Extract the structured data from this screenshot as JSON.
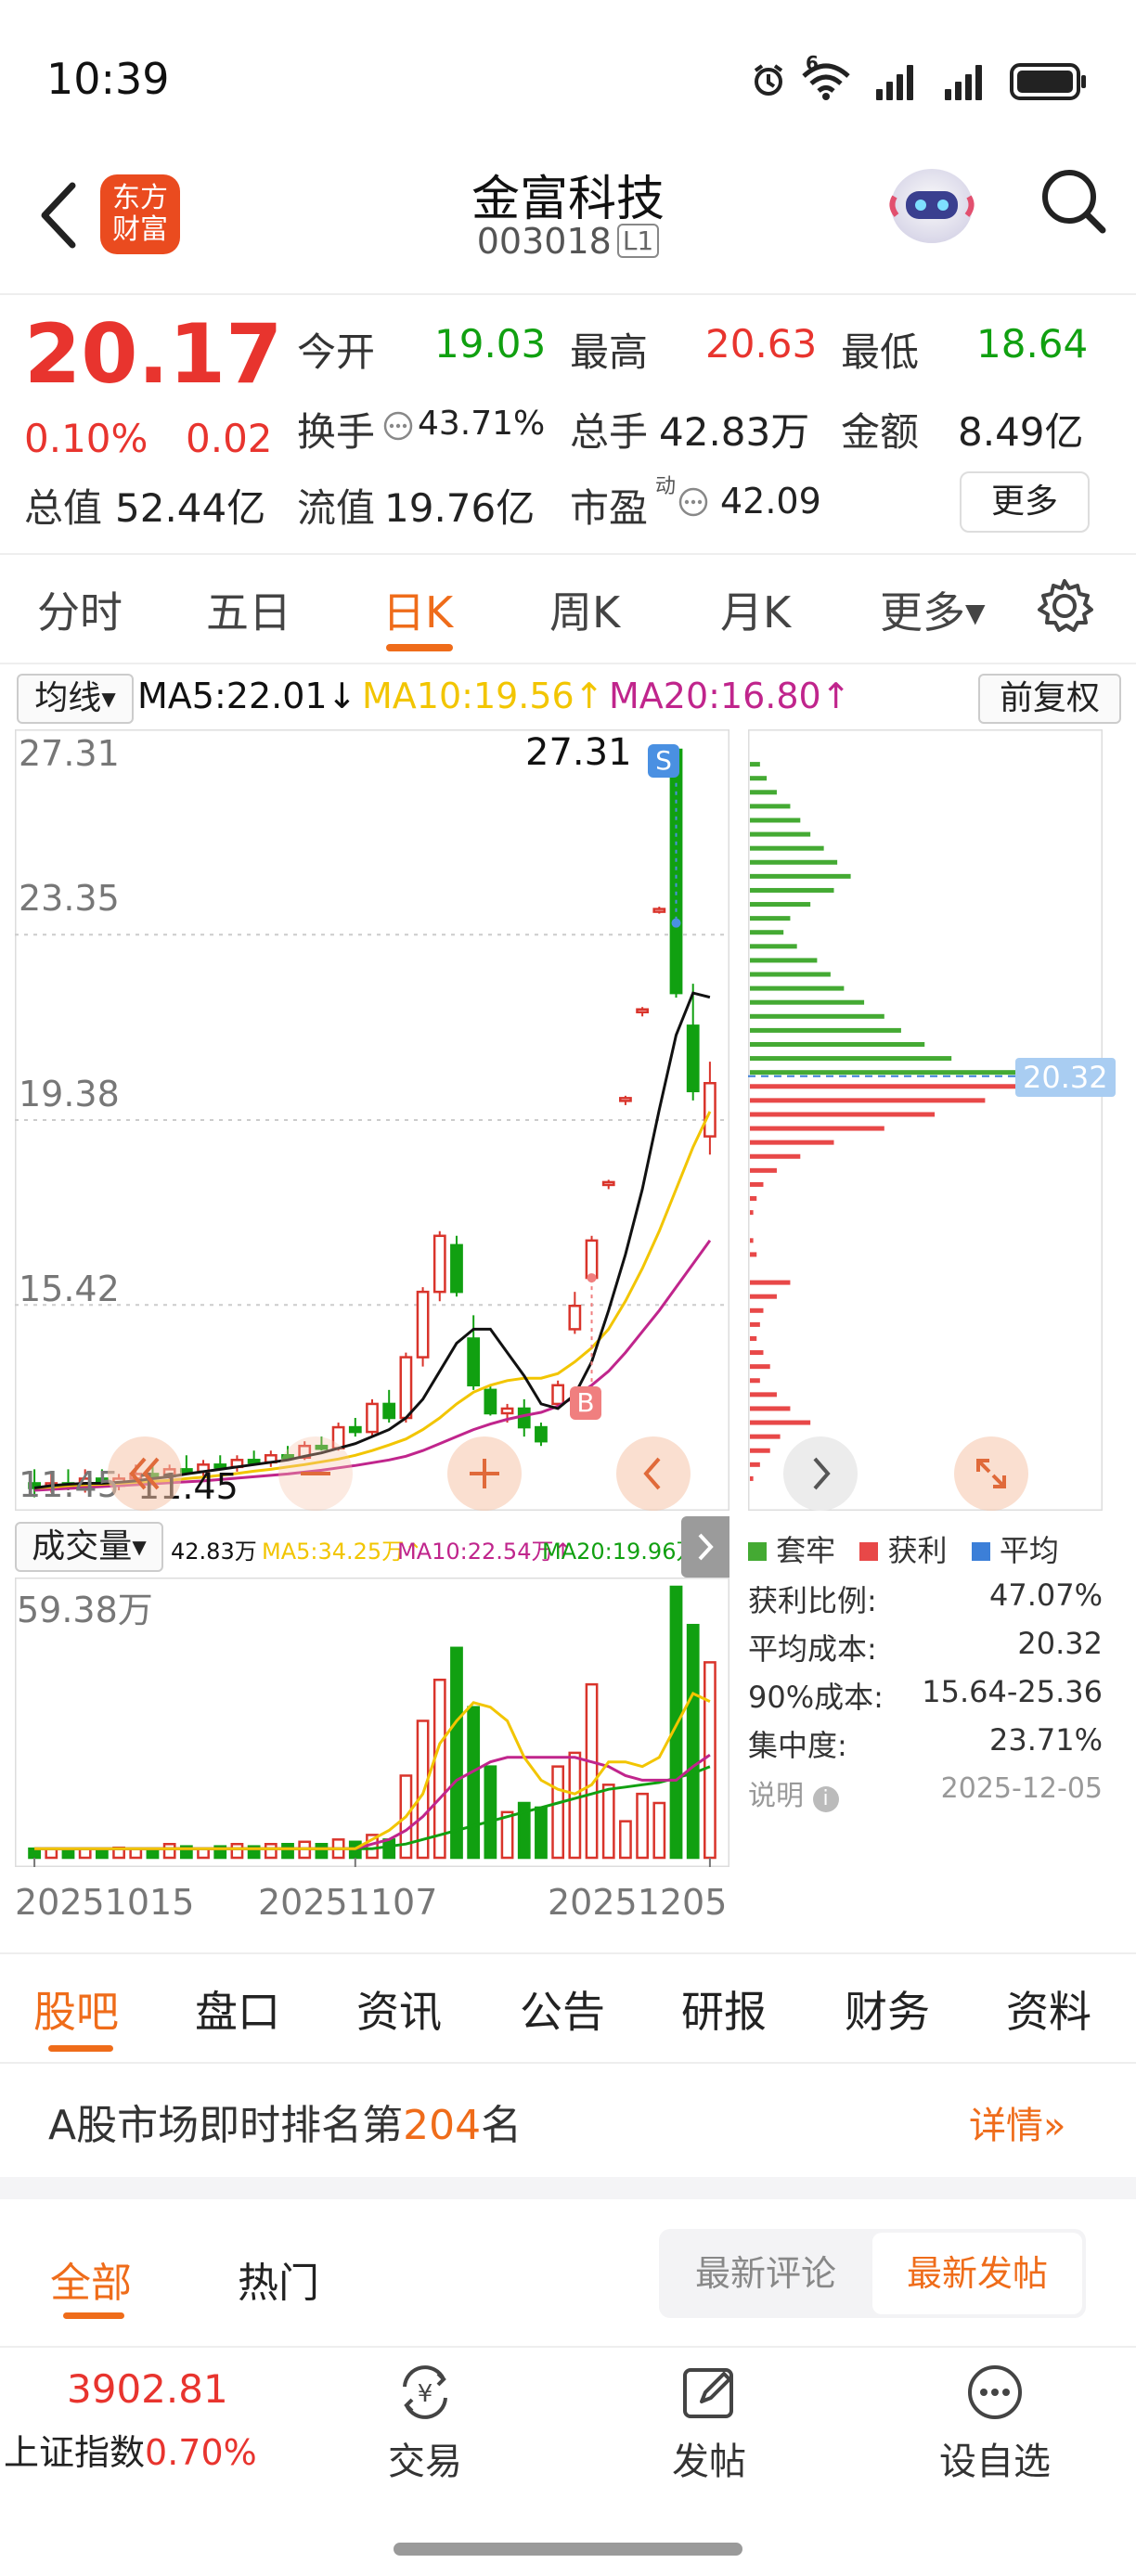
{
  "status_bar": {
    "time": "10:39",
    "wifi_label": "6"
  },
  "header": {
    "logo_line1": "东方",
    "logo_line2": "财富",
    "name": "金富科技",
    "code": "003018",
    "level": "L1"
  },
  "quote": {
    "price": "20.17",
    "change_pct": "0.10%",
    "change": "0.02",
    "open_label": "今开",
    "open": "19.03",
    "high_label": "最高",
    "high": "20.63",
    "low_label": "最低",
    "low": "18.64",
    "turnover_label": "换手",
    "turnover": "43.71%",
    "volume_label": "总手",
    "volume": "42.83万",
    "amount_label": "金额",
    "amount": "8.49亿",
    "mktcap_label": "总值",
    "mktcap": "52.44亿",
    "float_label": "流值",
    "float": "19.76亿",
    "pe_label": "市盈",
    "pe_sup": "动",
    "pe": "42.09",
    "more_label": "更多"
  },
  "period_tabs": [
    "分时",
    "五日",
    "日K",
    "周K",
    "月K",
    "更多"
  ],
  "ma_legend": {
    "selector": "均线",
    "ma5": "MA5:22.01",
    "ma10": "MA10:19.56",
    "ma20": "MA20:16.80",
    "adjust": "前复权",
    "ma5_color": "#111111",
    "ma10_color": "#f2c500",
    "ma20_color": "#c0258c"
  },
  "kline": {
    "y_labels": [
      "27.31",
      "23.35",
      "19.38",
      "15.42",
      "11.45"
    ],
    "max_marker": "27.31",
    "min_marker": "11.45",
    "sell_badge": "S",
    "buy_badge": "B",
    "up_color": "#d9342b",
    "down_color": "#11a011"
  },
  "chip": {
    "avg_price_tag": "20.32",
    "legend": [
      "套牢",
      "获利",
      "平均"
    ],
    "legend_colors": [
      "#44aa33",
      "#e84848",
      "#3c7fd8"
    ],
    "rows": [
      {
        "label": "获利比例:",
        "value": "47.07%"
      },
      {
        "label": "平均成本:",
        "value": "20.32"
      },
      {
        "label": "90%成本:",
        "value": "15.64-25.36"
      },
      {
        "label": "集中度:",
        "value": "23.71%"
      }
    ],
    "note_label": "说明",
    "note_date": "2025-12-05"
  },
  "volume_panel": {
    "selector": "成交量",
    "vol": "42.83万",
    "ma5": "MA5:34.25万",
    "ma10": "MA10:22.54万",
    "ma20": "MA20:19.96万",
    "max_label": "59.38万",
    "dates": [
      "20251015",
      "20251107",
      "20251205"
    ]
  },
  "content_tabs": [
    "股吧",
    "盘口",
    "资讯",
    "公告",
    "研报",
    "财务",
    "资料"
  ],
  "ranking": {
    "prefix": "A股市场即时排名第",
    "rank": "204",
    "suffix": "名",
    "detail": "详情"
  },
  "post_filters": {
    "tabs": [
      "全部",
      "热门"
    ],
    "sort": [
      "最新评论",
      "最新发帖"
    ]
  },
  "bottom_nav": {
    "index_value": "3902.81",
    "index_name": "上证指数",
    "index_change": "0.70%",
    "trade": "交易",
    "post": "发帖",
    "watch": "设自选"
  },
  "chart_data": {
    "type": "candlestick",
    "title": "",
    "y_range": [
      11.45,
      27.31
    ],
    "x_labels": [
      "20251015",
      "20251107",
      "20251205"
    ],
    "candles": [
      {
        "o": 11.6,
        "h": 11.9,
        "l": 11.3,
        "c": 11.5
      },
      {
        "o": 11.5,
        "h": 11.8,
        "l": 11.4,
        "c": 11.6
      },
      {
        "o": 11.6,
        "h": 11.9,
        "l": 11.45,
        "c": 11.55
      },
      {
        "o": 11.55,
        "h": 11.9,
        "l": 11.4,
        "c": 11.7
      },
      {
        "o": 11.7,
        "h": 11.9,
        "l": 11.5,
        "c": 11.55
      },
      {
        "o": 11.55,
        "h": 11.8,
        "l": 11.45,
        "c": 11.7
      },
      {
        "o": 11.7,
        "h": 12.0,
        "l": 11.6,
        "c": 11.8
      },
      {
        "o": 11.8,
        "h": 12.0,
        "l": 11.7,
        "c": 11.75
      },
      {
        "o": 11.75,
        "h": 12.0,
        "l": 11.6,
        "c": 11.9
      },
      {
        "o": 11.9,
        "h": 12.2,
        "l": 11.8,
        "c": 11.85
      },
      {
        "o": 11.85,
        "h": 12.1,
        "l": 11.7,
        "c": 12.0
      },
      {
        "o": 12.0,
        "h": 12.2,
        "l": 11.9,
        "c": 11.95
      },
      {
        "o": 11.95,
        "h": 12.2,
        "l": 11.85,
        "c": 12.1
      },
      {
        "o": 12.1,
        "h": 12.3,
        "l": 12.0,
        "c": 12.05
      },
      {
        "o": 12.05,
        "h": 12.3,
        "l": 11.95,
        "c": 12.2
      },
      {
        "o": 12.2,
        "h": 12.4,
        "l": 12.1,
        "c": 12.15
      },
      {
        "o": 12.15,
        "h": 12.5,
        "l": 12.1,
        "c": 12.4
      },
      {
        "o": 12.4,
        "h": 12.6,
        "l": 12.3,
        "c": 12.35
      },
      {
        "o": 12.35,
        "h": 12.9,
        "l": 12.3,
        "c": 12.8
      },
      {
        "o": 12.8,
        "h": 13.0,
        "l": 12.6,
        "c": 12.7
      },
      {
        "o": 12.7,
        "h": 13.4,
        "l": 12.6,
        "c": 13.3
      },
      {
        "o": 13.3,
        "h": 13.6,
        "l": 12.9,
        "c": 13.0
      },
      {
        "o": 13.0,
        "h": 14.4,
        "l": 12.9,
        "c": 14.3
      },
      {
        "o": 14.3,
        "h": 15.8,
        "l": 14.1,
        "c": 15.7
      },
      {
        "o": 15.7,
        "h": 17.0,
        "l": 15.5,
        "c": 16.9
      },
      {
        "o": 16.7,
        "h": 16.9,
        "l": 15.6,
        "c": 15.7
      },
      {
        "o": 14.7,
        "h": 15.2,
        "l": 13.6,
        "c": 13.7
      },
      {
        "o": 13.6,
        "h": 13.7,
        "l": 13.05,
        "c": 13.1
      },
      {
        "o": 13.1,
        "h": 13.3,
        "l": 12.9,
        "c": 13.2
      },
      {
        "o": 13.2,
        "h": 13.4,
        "l": 12.6,
        "c": 12.8
      },
      {
        "o": 12.8,
        "h": 12.9,
        "l": 12.4,
        "c": 12.5
      },
      {
        "o": 13.3,
        "h": 13.8,
        "l": 13.2,
        "c": 13.7
      },
      {
        "o": 14.9,
        "h": 15.7,
        "l": 14.8,
        "c": 15.4
      },
      {
        "o": 16.0,
        "h": 16.9,
        "l": 15.9,
        "c": 16.8
      },
      {
        "o": 18.0,
        "h": 18.1,
        "l": 17.9,
        "c": 18.05
      },
      {
        "o": 19.8,
        "h": 19.9,
        "l": 19.7,
        "c": 19.85
      },
      {
        "o": 21.7,
        "h": 21.8,
        "l": 21.6,
        "c": 21.75
      },
      {
        "o": 23.9,
        "h": 23.95,
        "l": 23.8,
        "c": 23.9
      },
      {
        "o": 27.31,
        "h": 27.31,
        "l": 22.0,
        "c": 22.1
      },
      {
        "o": 21.4,
        "h": 22.3,
        "l": 19.8,
        "c": 20.0
      },
      {
        "o": 19.03,
        "h": 20.63,
        "l": 18.64,
        "c": 20.17
      }
    ],
    "ma5": [
      11.5,
      11.55,
      11.58,
      11.6,
      11.6,
      11.62,
      11.65,
      11.7,
      11.74,
      11.8,
      11.85,
      11.9,
      11.95,
      12.0,
      12.05,
      12.1,
      12.18,
      12.25,
      12.35,
      12.45,
      12.6,
      12.75,
      13.0,
      13.4,
      14.0,
      14.6,
      14.9,
      14.9,
      14.4,
      13.9,
      13.3,
      13.2,
      13.5,
      14.2,
      15.3,
      16.5,
      17.9,
      19.6,
      21.2,
      22.1,
      22.01
    ],
    "ma10": [
      11.5,
      11.52,
      11.55,
      11.57,
      11.58,
      11.6,
      11.62,
      11.64,
      11.66,
      11.7,
      11.73,
      11.77,
      11.81,
      11.86,
      11.9,
      11.95,
      12.0,
      12.06,
      12.12,
      12.2,
      12.3,
      12.42,
      12.55,
      12.75,
      13.0,
      13.3,
      13.55,
      13.7,
      13.8,
      13.85,
      13.85,
      13.95,
      14.2,
      14.5,
      14.9,
      15.5,
      16.2,
      17.0,
      17.9,
      18.8,
      19.56
    ],
    "ma20": [
      11.45,
      11.47,
      11.49,
      11.51,
      11.53,
      11.55,
      11.57,
      11.59,
      11.61,
      11.63,
      11.65,
      11.68,
      11.71,
      11.74,
      11.77,
      11.8,
      11.84,
      11.88,
      11.93,
      11.98,
      12.04,
      12.1,
      12.18,
      12.3,
      12.45,
      12.6,
      12.75,
      12.87,
      12.97,
      13.05,
      13.12,
      13.25,
      13.45,
      13.7,
      14.0,
      14.4,
      14.85,
      15.3,
      15.8,
      16.3,
      16.8
    ],
    "volume_unit": "万",
    "volume": [
      2,
      2,
      1.5,
      2,
      1.8,
      2.2,
      2,
      2,
      3,
      2.5,
      2,
      2.5,
      3,
      2.5,
      3,
      3,
      3.5,
      3,
      4,
      3.5,
      5,
      4,
      18,
      30,
      39,
      46,
      33,
      20,
      10,
      12,
      11,
      20,
      23,
      38,
      16,
      8,
      14,
      12,
      59.38,
      51,
      42.83
    ],
    "volume_ma5": [
      2,
      2,
      2,
      2,
      2,
      2,
      2,
      2,
      2,
      2,
      2,
      2,
      2,
      2,
      2,
      2,
      2,
      2,
      2,
      2,
      4,
      6,
      9,
      14,
      25,
      30,
      34,
      33,
      30,
      22,
      17,
      15,
      14,
      16,
      21,
      21,
      20,
      22,
      29,
      36,
      34.25
    ],
    "volume_ma10": [
      2,
      2,
      2,
      2,
      2,
      2,
      2,
      2,
      2,
      2,
      2,
      2,
      2,
      2,
      2,
      2,
      2,
      2,
      2,
      2,
      3,
      4,
      6,
      9,
      13,
      17,
      19,
      21,
      22,
      22,
      22,
      22,
      22,
      21,
      20,
      18,
      17,
      17,
      17,
      20,
      22.54
    ],
    "volume_ma20": [
      2,
      2,
      2,
      2,
      2,
      2,
      2,
      2,
      2,
      2,
      2,
      2,
      2,
      2,
      2,
      2,
      2,
      2,
      2,
      2,
      2,
      2.5,
      3,
      4,
      5,
      6,
      7,
      8,
      9,
      10,
      11,
      12,
      13,
      14,
      15,
      15.5,
      16,
      16.5,
      17.5,
      18.5,
      19.96
    ],
    "chip_distribution": {
      "price_levels": [
        27.0,
        26.7,
        26.4,
        26.1,
        25.8,
        25.5,
        25.2,
        24.9,
        24.6,
        24.3,
        24.0,
        23.7,
        23.4,
        23.1,
        22.8,
        22.5,
        22.2,
        21.9,
        21.6,
        21.3,
        21.0,
        20.7,
        20.4,
        20.1,
        19.8,
        19.5,
        19.2,
        18.9,
        18.6,
        18.3,
        18.0,
        17.7,
        17.4,
        17.1,
        16.8,
        16.5,
        16.2,
        15.9,
        15.6,
        15.3,
        15.0,
        14.7,
        14.4,
        14.1,
        13.8,
        13.5,
        13.2,
        12.9,
        12.6,
        12.3,
        12.0,
        11.7
      ],
      "volume_share": [
        3,
        5,
        8,
        12,
        15,
        18,
        22,
        26,
        30,
        25,
        18,
        12,
        10,
        14,
        20,
        24,
        28,
        34,
        40,
        45,
        52,
        60,
        100,
        95,
        70,
        55,
        40,
        25,
        15,
        8,
        4,
        2,
        1,
        0,
        1,
        2,
        0,
        12,
        8,
        4,
        3,
        2,
        4,
        6,
        3,
        8,
        12,
        18,
        9,
        6,
        3,
        1
      ]
    }
  }
}
